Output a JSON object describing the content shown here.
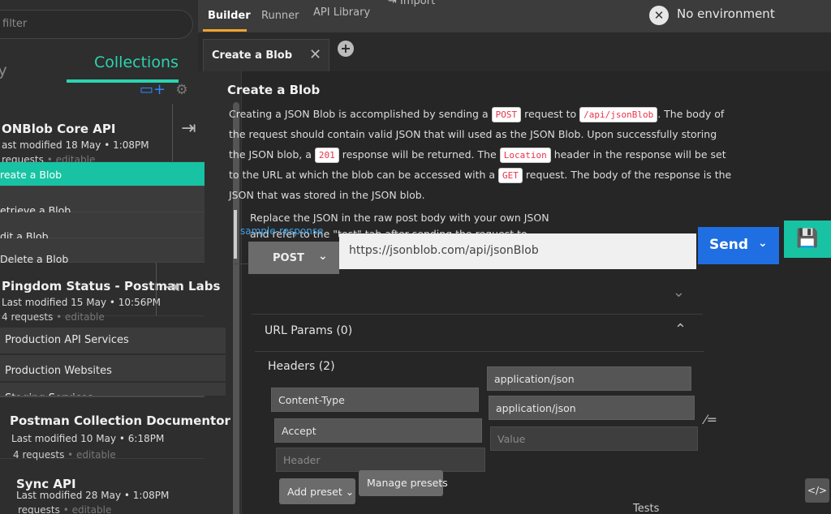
{
  "sidebar": {
    "filter_placeholder": "filter",
    "tab_history": "ory",
    "tab_collections": "Collections",
    "icons": {
      "new_folder": "new-folder-icon",
      "settings": "gear-icon"
    },
    "collections": [
      {
        "title": "ONBlob Core API",
        "modified": "ast modified 18 May • 1:08PM",
        "requests": "requests",
        "editable": "• editable",
        "items": [
          "reate a Blob",
          "etrieve a Blob",
          "dit a Blob",
          "Delete a Blob"
        ],
        "active_item": 0
      },
      {
        "title": "Pingdom Status - Postman Labs",
        "modified": "Last modified 15 May • 10:56PM",
        "requests": "4 requests",
        "editable": "• editable",
        "folders": [
          "Production API Services",
          "Production Websites",
          "Staging Services"
        ]
      },
      {
        "title": "Postman Collection Documentor",
        "modified": "Last modified 10 May • 6:18PM",
        "requests": "4 requests",
        "editable": "• editable"
      },
      {
        "title": "Sync API",
        "modified": "Last modified 28 May • 1:08PM",
        "requests": "requests",
        "editable": "• editable"
      }
    ]
  },
  "topbar": {
    "tabs": [
      "Builder",
      "Runner",
      "API Library",
      "Import"
    ],
    "environment": "No environment"
  },
  "request_tab": {
    "title": "Create a Blob",
    "close": "✕",
    "add": "+"
  },
  "description": {
    "title": "Create a Blob",
    "p1_a": "Creating a JSON Blob is accomplished by sending a",
    "code_post": "POST",
    "p1_b": "request to",
    "code_path": "/api/jsonBlob",
    "p1_c": ". The body of the request should contain valid JSON that will used as the JSON Blob. Upon successfully storing the JSON blob, a",
    "code_201": "201",
    "p1_d": "response will be returned. The",
    "code_location": "Location",
    "p1_e": "header in the response will be set to the URL at which the blob can be accessed with a",
    "code_get": "GET",
    "p1_f": "request. The body of the response is the JSON that was stored in the JSON blob.",
    "quote": "Replace the JSON in the raw post body with your own JSON and refer to the \"test\" tab after sending the request to easily retrieve the location of your newly created JSON",
    "sample_link": "sample-response"
  },
  "request": {
    "method": "POST",
    "url": "https://jsonblob.com/api/jsonBlob",
    "send": "Send",
    "url_params_label": "URL Params (0)",
    "headers_label": "Headers (2)",
    "headers": [
      {
        "key": "Content-Type",
        "value": "application/json"
      },
      {
        "key": "Accept",
        "value": "application/json"
      }
    ],
    "header_placeholder": "Header",
    "value_placeholder": "Value",
    "add_preset": "Add preset",
    "manage_presets": "Manage presets",
    "tests_tab": "Tests"
  },
  "colors": {
    "accent": "#17c3a3",
    "send": "#1f6fe3",
    "code_text": "#e8344a",
    "builder_underline": "#f0a32f"
  }
}
